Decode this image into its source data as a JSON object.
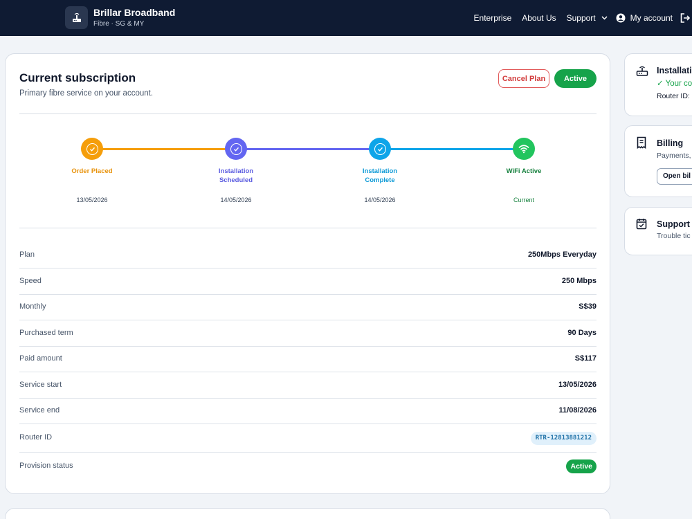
{
  "brand": {
    "name": "Brillar Broadband",
    "subtitle": "Fibre · SG & MY"
  },
  "nav": {
    "enterprise": "Enterprise",
    "about": "About Us",
    "support": "Support",
    "account": "My account"
  },
  "subscription": {
    "title": "Current subscription",
    "subtitle": "Primary fibre service on your account.",
    "cancel_label": "Cancel Plan",
    "status_label": "Active"
  },
  "steps": [
    {
      "label": "Order Placed",
      "date": "13/05/2026",
      "color": "#f59e0b",
      "icon": "check-icon"
    },
    {
      "label": "Installation Scheduled",
      "date": "14/05/2026",
      "color": "#6366f1",
      "icon": "check-icon"
    },
    {
      "label": "Installation Complete",
      "date": "14/05/2026",
      "color": "#0ea5e9",
      "icon": "check-icon"
    },
    {
      "label": "WiFi Active",
      "date": "Current",
      "color": "#22c55e",
      "icon": "wifi-icon"
    }
  ],
  "details": [
    {
      "label": "Plan",
      "value": "250Mbps Everyday"
    },
    {
      "label": "Speed",
      "value": "250 Mbps"
    },
    {
      "label": "Monthly",
      "value": "S$39"
    },
    {
      "label": "Purchased term",
      "value": "90 Days"
    },
    {
      "label": "Paid amount",
      "value": "S$117"
    },
    {
      "label": "Service start",
      "value": "13/05/2026"
    },
    {
      "label": "Service end",
      "value": "11/08/2026"
    }
  ],
  "router": {
    "label": "Router ID",
    "value": "RTR-12813881212"
  },
  "provision": {
    "label": "Provision status",
    "value": "Active"
  },
  "side_cards": {
    "installation": {
      "title": "Installati",
      "line1": "✓ Your co",
      "line2": "Router ID:"
    },
    "billing": {
      "title": "Billing",
      "line1": "Payments,",
      "button": "Open bil"
    },
    "support": {
      "title": "Support",
      "line1": "Trouble tic"
    }
  },
  "colors": {
    "nav_bg": "#0f1b33",
    "success": "#16a34a",
    "danger": "#d23b3b"
  }
}
